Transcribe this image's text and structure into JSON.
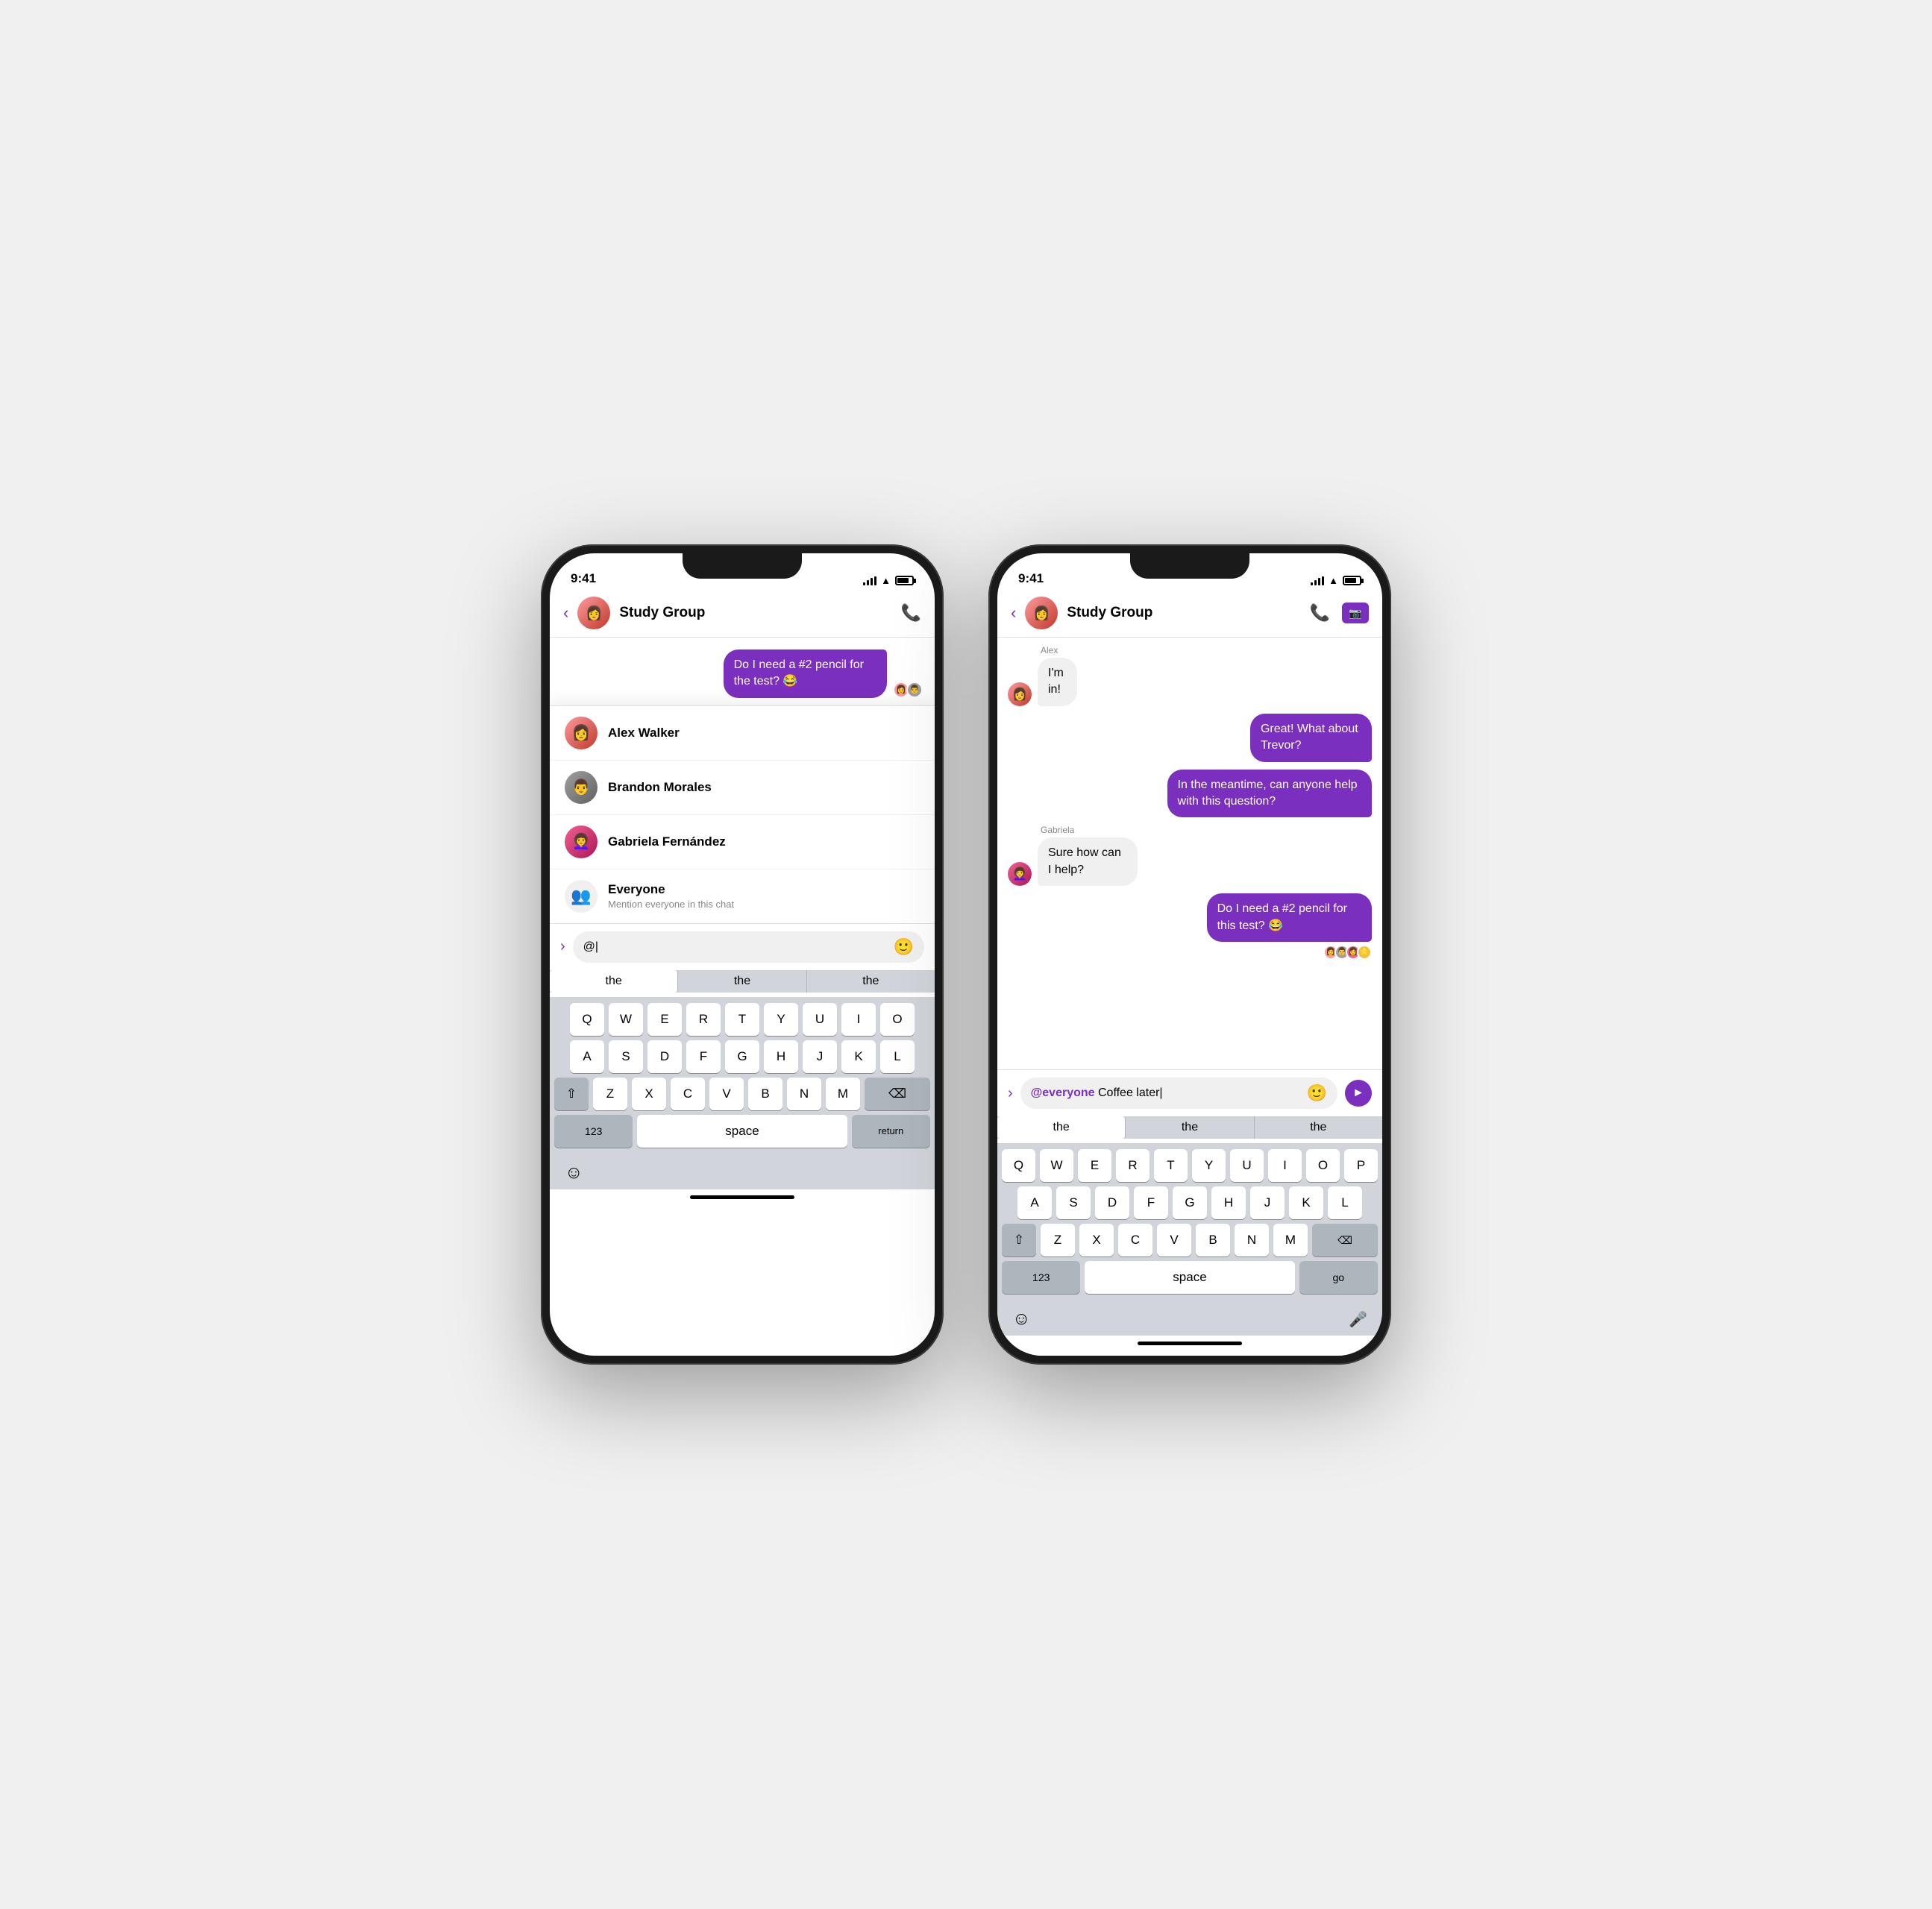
{
  "phone1": {
    "status": {
      "time": "9:41",
      "battery": "80"
    },
    "nav": {
      "title": "Study Group",
      "back_label": "‹"
    },
    "chat_message": {
      "text": "Do I need a #2 pencil for the test? 😂",
      "type": "outgoing"
    },
    "mention_list": {
      "items": [
        {
          "name": "Alex Walker",
          "avatar_emoji": "👩"
        },
        {
          "name": "Brandon Morales",
          "avatar_emoji": "👨"
        },
        {
          "name": "Gabriela Fernández",
          "avatar_emoji": "👩‍🦱"
        },
        {
          "name": "Everyone",
          "subtitle": "Mention everyone in this chat",
          "is_group": true
        }
      ]
    },
    "input": {
      "value": "@",
      "placeholder": "@"
    },
    "keyboard": {
      "suggestions": [
        "the",
        "the",
        "the"
      ],
      "rows": [
        [
          "Q",
          "W",
          "E",
          "R",
          "T",
          "Y",
          "U",
          "I",
          "O"
        ],
        [
          "A",
          "S",
          "D",
          "F",
          "G",
          "H",
          "J",
          "K",
          "L"
        ],
        [
          "Z",
          "X",
          "C",
          "V",
          "B",
          "N",
          "M"
        ],
        [
          "123",
          "space",
          "⌫"
        ]
      ]
    },
    "bottom_actions": {
      "emoji": "☺"
    }
  },
  "phone2": {
    "status": {
      "time": "9:41"
    },
    "nav": {
      "title": "Study Group",
      "back_label": "‹"
    },
    "messages": [
      {
        "sender": "Alex",
        "text": "I'm in!",
        "type": "incoming",
        "avatar": "alex"
      },
      {
        "text": "Great! What about Trevor?",
        "type": "outgoing"
      },
      {
        "text": "In the meantime, can anyone help with this question?",
        "type": "outgoing"
      },
      {
        "sender": "Gabriela",
        "text": "Sure how can I help?",
        "type": "incoming",
        "avatar": "gabriela"
      },
      {
        "text": "Do I need a #2 pencil for this test? 😂",
        "type": "outgoing",
        "reactions": true
      }
    ],
    "input": {
      "value": "@everyone Coffee later|",
      "mention_part": "@everyone",
      "text_part": " Coffee later"
    },
    "keyboard": {
      "suggestions": [
        "the",
        "the",
        "the"
      ],
      "rows": [
        [
          "Q",
          "W",
          "E",
          "R",
          "T",
          "Y",
          "U",
          "I",
          "O",
          "P"
        ],
        [
          "A",
          "S",
          "D",
          "F",
          "G",
          "H",
          "J",
          "K",
          "L"
        ],
        [
          "Z",
          "X",
          "C",
          "V",
          "B",
          "N",
          "M"
        ],
        [
          "123",
          "space",
          "go"
        ]
      ]
    },
    "bottom_actions": {
      "emoji": "☺",
      "mic": "🎤"
    }
  }
}
